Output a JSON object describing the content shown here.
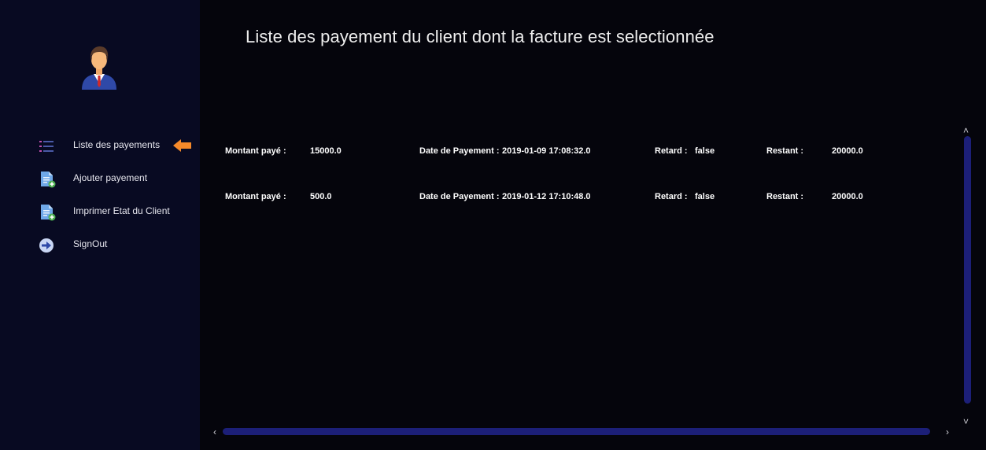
{
  "page": {
    "title": "Liste des payement du client dont la facture est selectionnée"
  },
  "sidebar": {
    "items": [
      {
        "label": "Liste des payements",
        "icon": "list-icon",
        "active": true
      },
      {
        "label": "Ajouter payement",
        "icon": "document-add-icon",
        "active": false
      },
      {
        "label": "Imprimer Etat du Client",
        "icon": "document-add-icon",
        "active": false
      },
      {
        "label": "SignOut",
        "icon": "arrow-right-circle-icon",
        "active": false
      }
    ]
  },
  "payments": {
    "labels": {
      "montant": "Montant payé :",
      "date": "Date de Payement :",
      "retard": "Retard :",
      "restant": "Restant :"
    },
    "rows": [
      {
        "montant": "15000.0",
        "date": "2019-01-09 17:08:32.0",
        "retard": "false",
        "restant": "20000.0"
      },
      {
        "montant": "500.0",
        "date": "2019-01-12 17:10:48.0",
        "retard": "false",
        "restant": "20000.0"
      }
    ]
  },
  "colors": {
    "sidebar_bg": "#080a22",
    "main_bg": "#05050c",
    "accent_arrow": "#f5892a",
    "scrollbar": "#1c1f78"
  }
}
